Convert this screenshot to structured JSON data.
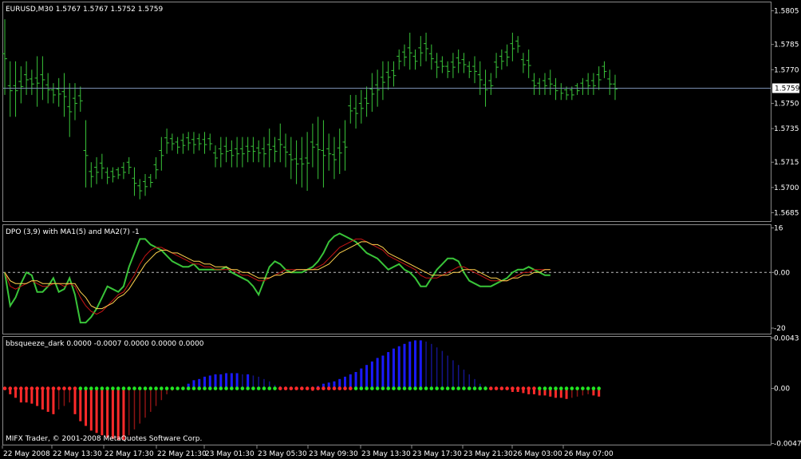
{
  "chart_data": [
    {
      "type": "ohlc",
      "title": "EURUSD,M30  1.5767 1.5767 1.5752 1.5759",
      "ylim": [
        1.568,
        1.581
      ],
      "y_ticks": [
        "1.5805",
        "1.5785",
        "1.5770",
        "1.5750",
        "1.5735",
        "1.5715",
        "1.5700",
        "1.5685"
      ],
      "y_tick_values": [
        1.5805,
        1.5785,
        1.577,
        1.575,
        1.5735,
        1.5715,
        1.57,
        1.5685
      ],
      "current_price": "1.5759",
      "current_price_value": 1.5759,
      "highs": [
        1.58,
        1.5775,
        1.5775,
        1.5772,
        1.5775,
        1.577,
        1.5778,
        1.5778,
        1.5768,
        1.5762,
        1.5765,
        1.5768,
        1.5762,
        1.5762,
        1.576,
        1.574,
        1.5715,
        1.5718,
        1.572,
        1.5712,
        1.5712,
        1.5712,
        1.5715,
        1.5718,
        1.5712,
        1.5705,
        1.5708,
        1.5708,
        1.5718,
        1.573,
        1.5735,
        1.5732,
        1.573,
        1.5732,
        1.5733,
        1.5733,
        1.5732,
        1.5733,
        1.5732,
        1.5725,
        1.573,
        1.573,
        1.5728,
        1.573,
        1.573,
        1.573,
        1.573,
        1.5728,
        1.573,
        1.5735,
        1.573,
        1.5738,
        1.5732,
        1.573,
        1.5728,
        1.573,
        1.5733,
        1.5738,
        1.5742,
        1.574,
        1.5732,
        1.573,
        1.5735,
        1.574,
        1.5755,
        1.5755,
        1.5758,
        1.576,
        1.5768,
        1.577,
        1.5775,
        1.5775,
        1.5775,
        1.5782,
        1.5785,
        1.5792,
        1.5782,
        1.579,
        1.5792,
        1.5785,
        1.578,
        1.5778,
        1.5775,
        1.578,
        1.5782,
        1.578,
        1.5775,
        1.5778,
        1.5775,
        1.577,
        1.5768,
        1.578,
        1.5782,
        1.5785,
        1.5792,
        1.579,
        1.578,
        1.5782,
        1.5768,
        1.5765,
        1.5768,
        1.577,
        1.5765,
        1.5762,
        1.576,
        1.576,
        1.5762,
        1.5765,
        1.5768,
        1.5768,
        1.5772,
        1.5775,
        1.577,
        1.5767
      ],
      "lows": [
        1.5755,
        1.5742,
        1.5742,
        1.575,
        1.5755,
        1.5755,
        1.5748,
        1.5752,
        1.575,
        1.575,
        1.5748,
        1.5742,
        1.573,
        1.574,
        1.5745,
        1.57,
        1.57,
        1.5702,
        1.5705,
        1.5702,
        1.5703,
        1.5705,
        1.5705,
        1.5708,
        1.5695,
        1.5693,
        1.5695,
        1.57,
        1.5705,
        1.571,
        1.572,
        1.5722,
        1.572,
        1.572,
        1.5722,
        1.572,
        1.5722,
        1.572,
        1.5722,
        1.5712,
        1.5712,
        1.5715,
        1.5712,
        1.5712,
        1.5712,
        1.5715,
        1.5715,
        1.5715,
        1.5712,
        1.5712,
        1.5715,
        1.5715,
        1.5712,
        1.5705,
        1.5702,
        1.57,
        1.5698,
        1.5712,
        1.5705,
        1.57,
        1.571,
        1.5705,
        1.5708,
        1.571,
        1.5738,
        1.5735,
        1.5738,
        1.5742,
        1.5745,
        1.5748,
        1.5752,
        1.5758,
        1.576,
        1.577,
        1.5772,
        1.577,
        1.577,
        1.5772,
        1.5775,
        1.577,
        1.5765,
        1.5768,
        1.5765,
        1.5765,
        1.5768,
        1.5768,
        1.5765,
        1.5762,
        1.5755,
        1.5748,
        1.5755,
        1.5765,
        1.577,
        1.5772,
        1.5775,
        1.578,
        1.5768,
        1.5765,
        1.5755,
        1.5755,
        1.5755,
        1.5755,
        1.5752,
        1.5752,
        1.5752,
        1.5752,
        1.5755,
        1.5755,
        1.5755,
        1.5755,
        1.5758,
        1.5765,
        1.5755,
        1.5752
      ]
    },
    {
      "type": "line",
      "title": "DPO (3,9) with MA1(5) and MA2(7) -1",
      "ylim": [
        -22,
        17
      ],
      "y_ticks": [
        "16",
        "0.00",
        "-20"
      ],
      "y_tick_values": [
        16,
        0,
        -20
      ],
      "series": [
        {
          "color": "#39c439",
          "values": [
            0,
            -12,
            -9,
            -4,
            0,
            -1,
            -7,
            -7,
            -5,
            -2,
            -7,
            -6,
            -2,
            -8,
            -18,
            -18,
            -16,
            -13,
            -9,
            -5,
            -6,
            -7,
            -5,
            2,
            7,
            12,
            12,
            10,
            9,
            8,
            6,
            4,
            3,
            2,
            2,
            3,
            1,
            1,
            1,
            1,
            1,
            2,
            0,
            -1,
            -2,
            -3,
            -5,
            -8,
            -3,
            2,
            4,
            3,
            1,
            0,
            0,
            0,
            1,
            2,
            4,
            7,
            11,
            13,
            14,
            13,
            12,
            11,
            9,
            7,
            6,
            5,
            3,
            1,
            2,
            3,
            1,
            0,
            -2,
            -5,
            -5,
            -2,
            1,
            3,
            5,
            5,
            4,
            0,
            -3,
            -4,
            -5,
            -5,
            -5,
            -4,
            -3,
            -2,
            0,
            1,
            1,
            2,
            1,
            0,
            -1,
            -1
          ]
        },
        {
          "color": "#c81414",
          "values": [
            0,
            -5,
            -6,
            -5,
            -4,
            -3,
            -4,
            -5,
            -5,
            -4,
            -4,
            -5,
            -4,
            -5,
            -9,
            -12,
            -14,
            -15,
            -14,
            -12,
            -10,
            -8,
            -7,
            -4,
            -1,
            3,
            6,
            8,
            9,
            9,
            8,
            7,
            6,
            5,
            4,
            3,
            3,
            2,
            2,
            1,
            1,
            1,
            1,
            0,
            -1,
            -1,
            -2,
            -3,
            -3,
            -2,
            -1,
            0,
            1,
            1,
            1,
            1,
            1,
            1,
            2,
            3,
            5,
            7,
            9,
            10,
            11,
            12,
            12,
            11,
            10,
            9,
            8,
            6,
            5,
            4,
            3,
            2,
            1,
            -1,
            -2,
            -2,
            -2,
            -1,
            0,
            1,
            2,
            2,
            1,
            0,
            -1,
            -2,
            -3,
            -3,
            -3,
            -3,
            -2,
            -1,
            0,
            0,
            1,
            1,
            1,
            1
          ]
        },
        {
          "color": "#ffd24d",
          "values": [
            0,
            -3,
            -4,
            -4,
            -4,
            -3,
            -3,
            -4,
            -4,
            -4,
            -4,
            -4,
            -4,
            -4,
            -7,
            -9,
            -12,
            -13,
            -13,
            -12,
            -11,
            -9,
            -8,
            -6,
            -3,
            0,
            3,
            5,
            7,
            8,
            8,
            7,
            7,
            6,
            5,
            4,
            4,
            3,
            3,
            2,
            2,
            2,
            1,
            1,
            0,
            0,
            -1,
            -2,
            -2,
            -2,
            -1,
            -1,
            0,
            0,
            1,
            1,
            1,
            1,
            1,
            2,
            3,
            5,
            7,
            8,
            9,
            10,
            11,
            11,
            10,
            10,
            9,
            7,
            6,
            5,
            4,
            3,
            2,
            1,
            0,
            -1,
            -1,
            -1,
            -1,
            0,
            0,
            1,
            1,
            1,
            0,
            -1,
            -2,
            -2,
            -3,
            -3,
            -2,
            -2,
            -1,
            -1,
            0,
            0,
            1,
            1
          ]
        }
      ]
    },
    {
      "type": "bar",
      "title": "bbsqueeze_dark 0.0000 -0.0007 0.0000 0.0000 0.0000",
      "ylim": [
        -0.0048,
        0.0044
      ],
      "y_ticks": [
        "0.0043",
        "0.00",
        "-0.0047"
      ],
      "y_tick_values": [
        0.0043,
        0,
        -0.0047
      ],
      "values": [
        0,
        -0.0005,
        -0.0008,
        -0.0012,
        -0.0012,
        -0.0013,
        -0.0015,
        -0.0018,
        -0.002,
        -0.0022,
        -0.0018,
        -0.0015,
        -0.0012,
        -0.0022,
        -0.0028,
        -0.0032,
        -0.0036,
        -0.0038,
        -0.004,
        -0.0042,
        -0.0043,
        -0.0044,
        -0.0044,
        -0.004,
        -0.0035,
        -0.003,
        -0.0025,
        -0.002,
        -0.0015,
        -0.001,
        -0.0005,
        -0.0002,
        0,
        0.0001,
        0.0004,
        0.0007,
        0.0008,
        0.001,
        0.0011,
        0.0012,
        0.0012,
        0.0013,
        0.0013,
        0.0013,
        0.0012,
        0.0012,
        0.0011,
        0.001,
        0.0008,
        0.0006,
        0.0003,
        0.0002,
        0.0001,
        0,
        0,
        0,
        -0.0001,
        -0.0002,
        0.0002,
        0.0004,
        0.0005,
        0.0006,
        0.0008,
        0.001,
        0.0012,
        0.0014,
        0.0017,
        0.002,
        0.0023,
        0.0026,
        0.0028,
        0.0031,
        0.0034,
        0.0036,
        0.0038,
        0.004,
        0.0041,
        0.0041,
        0.004,
        0.0038,
        0.0035,
        0.0032,
        0.0028,
        0.0024,
        0.002,
        0.0016,
        0.0012,
        0.0008,
        0.0004,
        0.0002,
        0.0001,
        0,
        0,
        -0.0001,
        -0.0003,
        -0.0003,
        -0.0004,
        -0.0005,
        -0.0005,
        -0.0006,
        -0.0006,
        -0.0007,
        -0.0008,
        -0.0008,
        -0.0009,
        -0.0008,
        -0.0007,
        -0.0006,
        -0.0005,
        -0.0006,
        -0.0007
      ],
      "squeeze_on": [
        true,
        true,
        true,
        true,
        true,
        true,
        true,
        true,
        true,
        true,
        true,
        true,
        true,
        true,
        false,
        false,
        false,
        false,
        false,
        false,
        false,
        false,
        false,
        false,
        false,
        false,
        false,
        false,
        false,
        false,
        false,
        false,
        false,
        false,
        false,
        false,
        false,
        false,
        false,
        false,
        false,
        false,
        false,
        false,
        false,
        false,
        false,
        false,
        false,
        false,
        false,
        true,
        true,
        true,
        true,
        true,
        true,
        true,
        true,
        true,
        true,
        true,
        true,
        true,
        true,
        false,
        false,
        false,
        false,
        false,
        false,
        false,
        false,
        false,
        false,
        false,
        false,
        false,
        false,
        false,
        false,
        false,
        false,
        false,
        false,
        false,
        false,
        false,
        false,
        false,
        true,
        true,
        true,
        true,
        true,
        true,
        true,
        true,
        true,
        false,
        false,
        false,
        false,
        false,
        false,
        false,
        false,
        false,
        false,
        false,
        false
      ],
      "colors": {
        "pos_strong": "#1a1aff",
        "pos_weak": "#14148c",
        "neg_strong": "#ff2a2a",
        "neg_weak": "#8c1414",
        "dot_on": "#ff2a2a",
        "dot_off": "#22e622"
      },
      "footer": "MIFX Trader, © 2001-2008 MetaQuotes Software Corp."
    }
  ],
  "x_axis": {
    "labels": [
      "22 May 2008",
      "22 May 13:30",
      "22 May 17:30",
      "22 May 21:30",
      "23 May 01:30",
      "23 May 05:30",
      "23 May 09:30",
      "23 May 13:30",
      "23 May 17:30",
      "23 May 21:30",
      "26 May 03:00",
      "26 May 07:00"
    ]
  },
  "colors": {
    "background": "#000000",
    "grid_border": "#8a8a8a",
    "text": "#ffffff",
    "bars": "#39c439",
    "current_line": "#7a8fb0",
    "price_box": "#ffffff"
  }
}
